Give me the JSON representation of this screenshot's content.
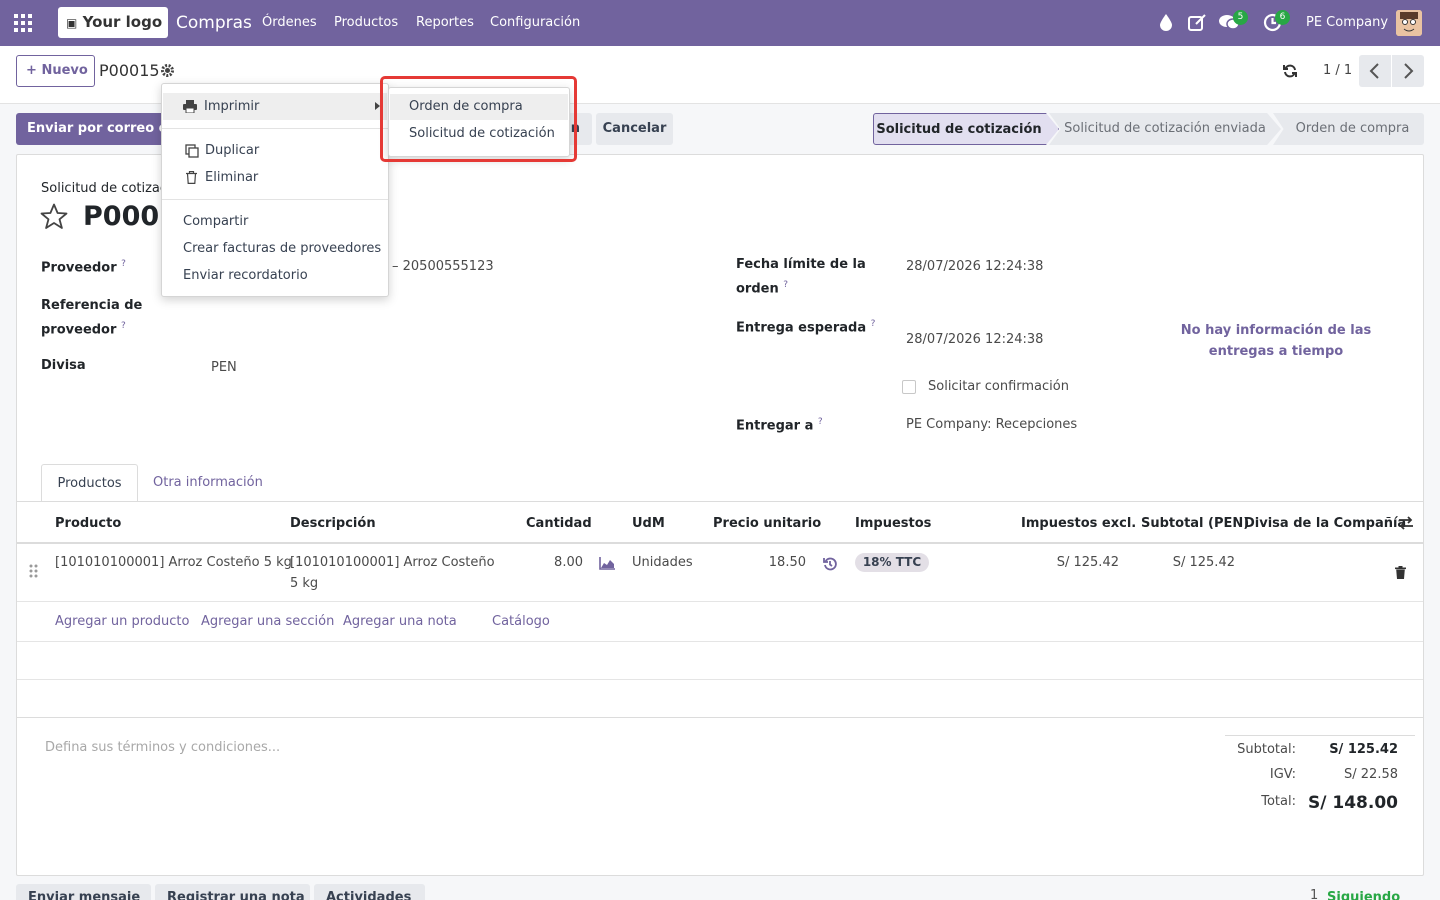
{
  "topnav": {
    "logo_text": "Your logo",
    "app_name": "Compras",
    "menu": [
      "Órdenes",
      "Productos",
      "Reportes",
      "Configuración"
    ],
    "messages_count": "5",
    "activities_count": "6",
    "company": "PE Company"
  },
  "control_panel": {
    "new_label": "Nuevo",
    "record_name": "P00015",
    "pager": "1 / 1"
  },
  "actions": {
    "send_email": "Enviar por correo electrónico",
    "confirm_fragment": "n",
    "cancel": "Cancelar"
  },
  "stages": [
    "Solicitud de cotización",
    "Solicitud de cotización enviada",
    "Orden de compra"
  ],
  "form": {
    "doc_type_label": "Solicitud de cotización",
    "doc_number": "P00015",
    "vendor_label": "Proveedor",
    "vendor_value": "– 20500555123",
    "vendor_ref_label_1": "Referencia de",
    "vendor_ref_label_2": "proveedor",
    "currency_label": "Divisa",
    "currency_value": "PEN",
    "deadline_label_1": "Fecha límite de la",
    "deadline_label_2": "orden",
    "deadline_value": "28/07/2026 12:24:38",
    "expected_label": "Entrega esperada",
    "expected_value": "28/07/2026 12:24:38",
    "ontime_1": "No hay información de las",
    "ontime_2": "entregas a tiempo",
    "ask_confirm": "Solicitar confirmación",
    "deliver_to_label": "Entregar a",
    "deliver_to_value": "PE Company: Recepciones"
  },
  "tabs": [
    "Productos",
    "Otra información"
  ],
  "table": {
    "headers": [
      "Producto",
      "Descripción",
      "Cantidad",
      "UdM",
      "Precio unitario",
      "Impuestos",
      "Impuestos excl.",
      "Subtotal (PEN)",
      "Divisa de la Compañía"
    ],
    "row": {
      "product": "[101010100001] Arroz Costeño 5 kg",
      "description_1": "[101010100001] Arroz Costeño",
      "description_2": "5 kg",
      "quantity": "8.00",
      "uom": "Unidades",
      "price": "18.50",
      "tax": "18% TTC",
      "tax_excl": "S/ 125.42",
      "subtotal": "S/ 125.42"
    },
    "add_links": [
      "Agregar un producto",
      "Agregar una sección",
      "Agregar una nota",
      "Catálogo"
    ]
  },
  "terms_placeholder": "Defina sus términos y condiciones...",
  "totals": {
    "subtotal_label": "Subtotal:",
    "subtotal_value": "S/ 125.42",
    "igv_label": "IGV:",
    "igv_value": "S/ 22.58",
    "total_label": "Total:",
    "total_value": "S/ 148.00"
  },
  "gear_menu": {
    "print": "Imprimir",
    "duplicate": "Duplicar",
    "delete": "Eliminar",
    "share": "Compartir",
    "create_bills": "Crear facturas de proveedores",
    "send_reminder": "Enviar recordatorio"
  },
  "print_submenu": [
    "Orden de compra",
    "Solicitud de cotización"
  ],
  "chatter": {
    "send_message": "Enviar mensaje",
    "log_note": "Registrar una nota",
    "activities": "Actividades",
    "followers": "1",
    "following": "Siguiendo"
  },
  "colors": {
    "brand": "#71639e",
    "badge": "#28a745",
    "highlight": "#e53935"
  }
}
